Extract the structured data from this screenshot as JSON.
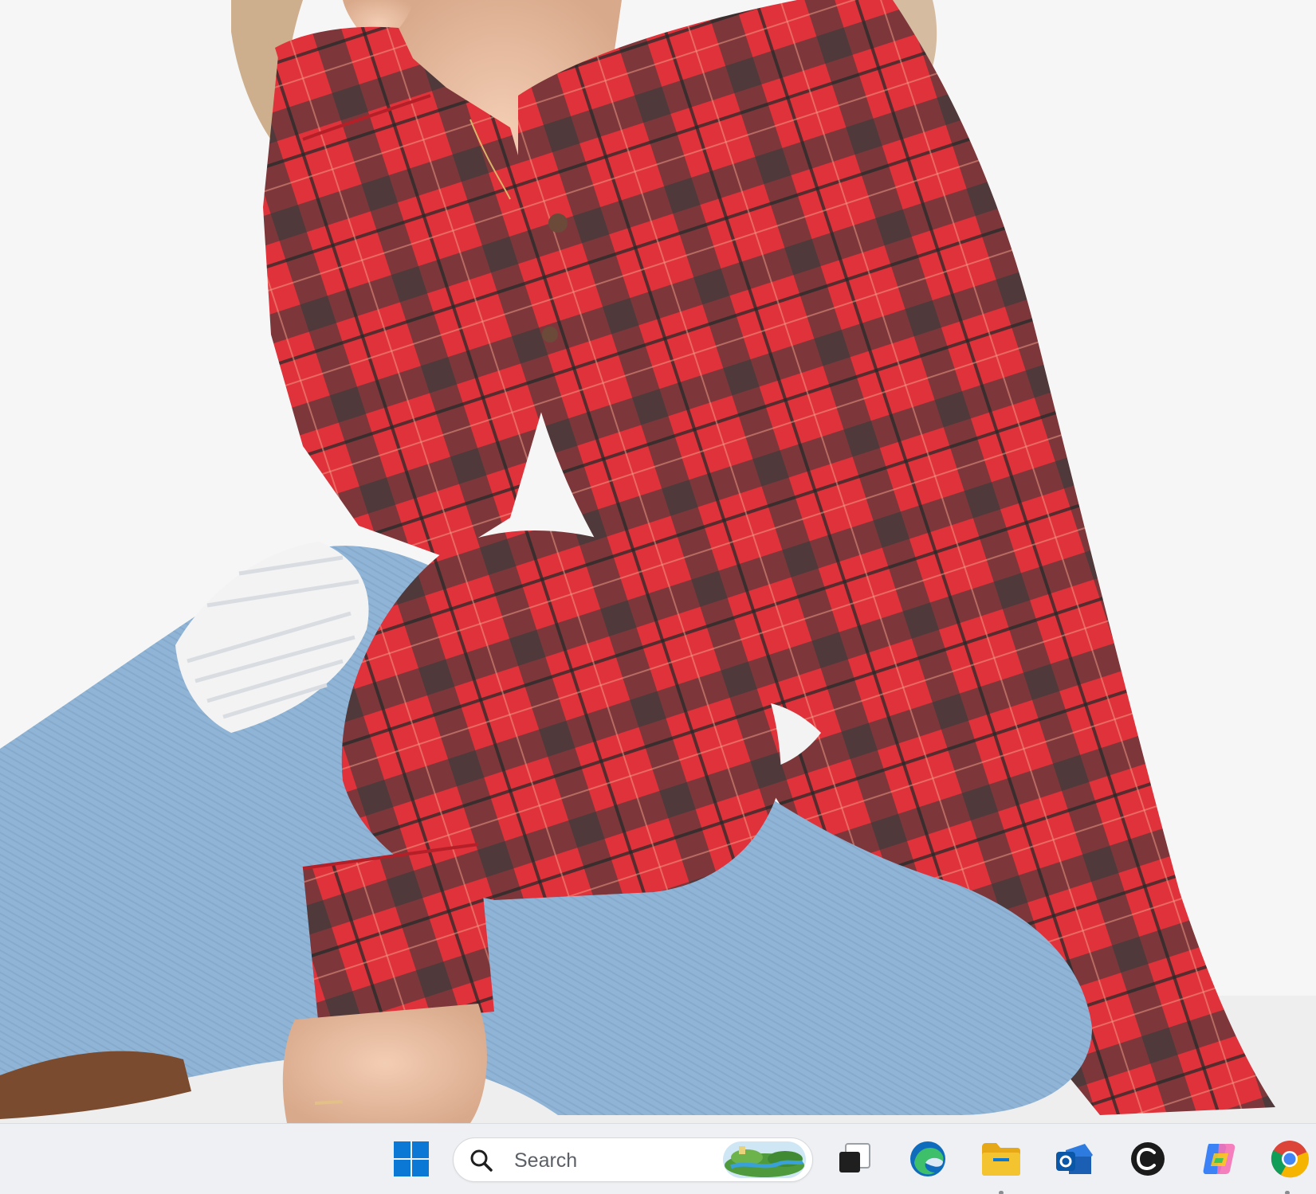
{
  "taskbar": {
    "search": {
      "label": "Search"
    },
    "items": [
      {
        "name": "start",
        "icon": "windows-logo-icon"
      },
      {
        "name": "search",
        "icon": "search-icon"
      },
      {
        "name": "search-highlight",
        "icon": "landscape-highlight-icon"
      },
      {
        "name": "task-view",
        "icon": "task-view-icon"
      },
      {
        "name": "edge",
        "icon": "edge-browser-icon"
      },
      {
        "name": "file-explorer",
        "icon": "folder-icon"
      },
      {
        "name": "outlook",
        "icon": "outlook-icon"
      },
      {
        "name": "ccleaner",
        "icon": "c-app-icon"
      },
      {
        "name": "copilot",
        "icon": "copilot-icon"
      },
      {
        "name": "chrome",
        "icon": "chrome-icon"
      }
    ],
    "colors": {
      "background": "#eef0f3",
      "windows_blue": "#0a78d4",
      "folder_yellow": "#f4c430",
      "edge_blue": "#0f6cbd",
      "edge_green": "#3ec06b"
    }
  },
  "photo": {
    "icon": "plaid-shirt-photo",
    "colors": {
      "shirt_red": "#e0323a",
      "plaid_dark": "#2c3a3a",
      "denim": "#8fb3d4",
      "background": "#f6f6f6"
    }
  }
}
